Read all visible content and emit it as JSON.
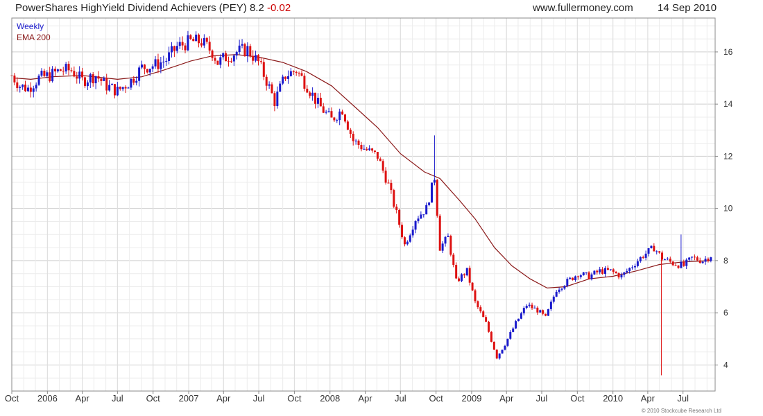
{
  "header": {
    "title": "PowerShares HighYield Dividend Achievers (PEY)",
    "price": "8.2",
    "change": "-0.02",
    "site": "www.fullermoney.com",
    "date": "14 Sep 2010"
  },
  "legend": {
    "series1": "Weekly",
    "series2": "EMA 200"
  },
  "credit": "© 2010 Stockcube Research Ltd",
  "colors": {
    "up": "#1a1acc",
    "down": "#dd1111",
    "ema": "#8b1a1a",
    "grid": "#dddddd",
    "axis": "#888888"
  },
  "chart_data": {
    "type": "line",
    "grid": true,
    "legend_position": "top-left",
    "y_axis_side": "right",
    "ylim": [
      3.0,
      17.3
    ],
    "y_ticks": [
      4,
      6,
      8,
      10,
      12,
      14,
      16
    ],
    "x_range": [
      "2005-10-01",
      "2010-09-22"
    ],
    "x_ticks": [
      {
        "label": "Oct",
        "date": "2005-10-01"
      },
      {
        "label": "2006",
        "date": "2006-01-01"
      },
      {
        "label": "Apr",
        "date": "2006-04-01"
      },
      {
        "label": "Jul",
        "date": "2006-07-01"
      },
      {
        "label": "Oct",
        "date": "2006-10-01"
      },
      {
        "label": "2007",
        "date": "2007-01-01"
      },
      {
        "label": "Apr",
        "date": "2007-04-01"
      },
      {
        "label": "Jul",
        "date": "2007-07-01"
      },
      {
        "label": "Oct",
        "date": "2007-10-01"
      },
      {
        "label": "2008",
        "date": "2008-01-01"
      },
      {
        "label": "Apr",
        "date": "2008-04-01"
      },
      {
        "label": "Jul",
        "date": "2008-07-01"
      },
      {
        "label": "Oct",
        "date": "2008-10-01"
      },
      {
        "label": "2009",
        "date": "2009-01-01"
      },
      {
        "label": "Apr",
        "date": "2009-04-01"
      },
      {
        "label": "Jul",
        "date": "2009-07-01"
      },
      {
        "label": "Oct",
        "date": "2009-10-01"
      },
      {
        "label": "2010",
        "date": "2010-01-01"
      },
      {
        "label": "Apr",
        "date": "2010-04-01"
      },
      {
        "label": "Jul",
        "date": "2010-07-01"
      }
    ],
    "series": [
      {
        "name": "Weekly",
        "points": [
          [
            "2005-10-01",
            15.1
          ],
          [
            "2005-10-22",
            14.7
          ],
          [
            "2005-11-12",
            14.6
          ],
          [
            "2005-12-10",
            15.0
          ],
          [
            "2006-01-07",
            15.1
          ],
          [
            "2006-02-04",
            15.3
          ],
          [
            "2006-03-04",
            15.3
          ],
          [
            "2006-04-01",
            14.9
          ],
          [
            "2006-05-06",
            15.1
          ],
          [
            "2006-06-03",
            14.7
          ],
          [
            "2006-07-01",
            14.5
          ],
          [
            "2006-08-05",
            14.9
          ],
          [
            "2006-09-02",
            15.4
          ],
          [
            "2006-10-07",
            15.5
          ],
          [
            "2006-11-04",
            15.7
          ],
          [
            "2006-12-02",
            16.2
          ],
          [
            "2007-01-06",
            16.4
          ],
          [
            "2007-02-03",
            16.4
          ],
          [
            "2007-03-03",
            16.0
          ],
          [
            "2007-03-17",
            15.6
          ],
          [
            "2007-04-07",
            15.8
          ],
          [
            "2007-05-05",
            16.0
          ],
          [
            "2007-06-02",
            16.1
          ],
          [
            "2007-06-30",
            15.6
          ],
          [
            "2007-07-21",
            14.9
          ],
          [
            "2007-08-11",
            14.1
          ],
          [
            "2007-09-08",
            15.1
          ],
          [
            "2007-10-06",
            15.3
          ],
          [
            "2007-11-03",
            14.7
          ],
          [
            "2007-12-01",
            14.0
          ],
          [
            "2008-01-05",
            13.4
          ],
          [
            "2008-02-02",
            13.8
          ],
          [
            "2008-03-01",
            12.6
          ],
          [
            "2008-03-29",
            12.3
          ],
          [
            "2008-05-03",
            12.0
          ],
          [
            "2008-05-31",
            10.9
          ],
          [
            "2008-06-21",
            9.8
          ],
          [
            "2008-07-12",
            8.6
          ],
          [
            "2008-08-09",
            9.6
          ],
          [
            "2008-09-06",
            10.0
          ],
          [
            "2008-09-27",
            11.2
          ],
          [
            "2008-10-11",
            8.5
          ],
          [
            "2008-11-01",
            8.9
          ],
          [
            "2008-11-22",
            7.2
          ],
          [
            "2008-12-20",
            7.6
          ],
          [
            "2009-01-10",
            6.4
          ],
          [
            "2009-02-07",
            5.6
          ],
          [
            "2009-03-07",
            4.3
          ],
          [
            "2009-03-28",
            4.8
          ],
          [
            "2009-04-25",
            5.6
          ],
          [
            "2009-05-23",
            6.3
          ],
          [
            "2009-06-20",
            6.1
          ],
          [
            "2009-07-11",
            5.8
          ],
          [
            "2009-08-08",
            6.9
          ],
          [
            "2009-09-05",
            7.2
          ],
          [
            "2009-10-03",
            7.5
          ],
          [
            "2009-10-31",
            7.4
          ],
          [
            "2009-11-28",
            7.6
          ],
          [
            "2009-12-26",
            7.6
          ],
          [
            "2010-01-23",
            7.4
          ],
          [
            "2010-02-20",
            7.8
          ],
          [
            "2010-03-20",
            8.2
          ],
          [
            "2010-04-17",
            8.5
          ],
          [
            "2010-05-08",
            8.1
          ],
          [
            "2010-06-05",
            7.9
          ],
          [
            "2010-07-03",
            7.8
          ],
          [
            "2010-07-24",
            8.1
          ],
          [
            "2010-08-21",
            8.0
          ],
          [
            "2010-09-11",
            8.2
          ]
        ]
      },
      {
        "name": "EMA 200",
        "points": [
          [
            "2005-10-08",
            15.0
          ],
          [
            "2005-11-19",
            14.95
          ],
          [
            "2006-01-14",
            15.05
          ],
          [
            "2006-04-01",
            15.1
          ],
          [
            "2006-07-01",
            14.95
          ],
          [
            "2006-09-02",
            15.05
          ],
          [
            "2006-10-28",
            15.3
          ],
          [
            "2007-01-06",
            15.65
          ],
          [
            "2007-03-03",
            15.85
          ],
          [
            "2007-05-05",
            15.9
          ],
          [
            "2007-07-01",
            15.8
          ],
          [
            "2007-09-01",
            15.6
          ],
          [
            "2007-11-01",
            15.25
          ],
          [
            "2008-01-05",
            14.7
          ],
          [
            "2008-03-01",
            13.95
          ],
          [
            "2008-05-03",
            13.1
          ],
          [
            "2008-07-01",
            12.1
          ],
          [
            "2008-09-01",
            11.4
          ],
          [
            "2008-10-11",
            11.15
          ],
          [
            "2008-12-01",
            10.3
          ],
          [
            "2009-01-10",
            9.6
          ],
          [
            "2009-03-01",
            8.5
          ],
          [
            "2009-04-15",
            7.8
          ],
          [
            "2009-06-01",
            7.3
          ],
          [
            "2009-07-15",
            6.95
          ],
          [
            "2009-09-01",
            7.0
          ],
          [
            "2009-11-01",
            7.3
          ],
          [
            "2010-01-01",
            7.4
          ],
          [
            "2010-03-01",
            7.6
          ],
          [
            "2010-05-01",
            7.85
          ],
          [
            "2010-07-01",
            7.95
          ],
          [
            "2010-09-11",
            8.0
          ]
        ]
      }
    ],
    "annotations": [
      {
        "label": "spike low",
        "date": "2010-05-06",
        "value": 3.6
      },
      {
        "label": "spike high",
        "date": "2008-09-27",
        "value": 12.8
      },
      {
        "label": "spike high",
        "date": "2010-06-26",
        "value": 9.0
      }
    ]
  }
}
